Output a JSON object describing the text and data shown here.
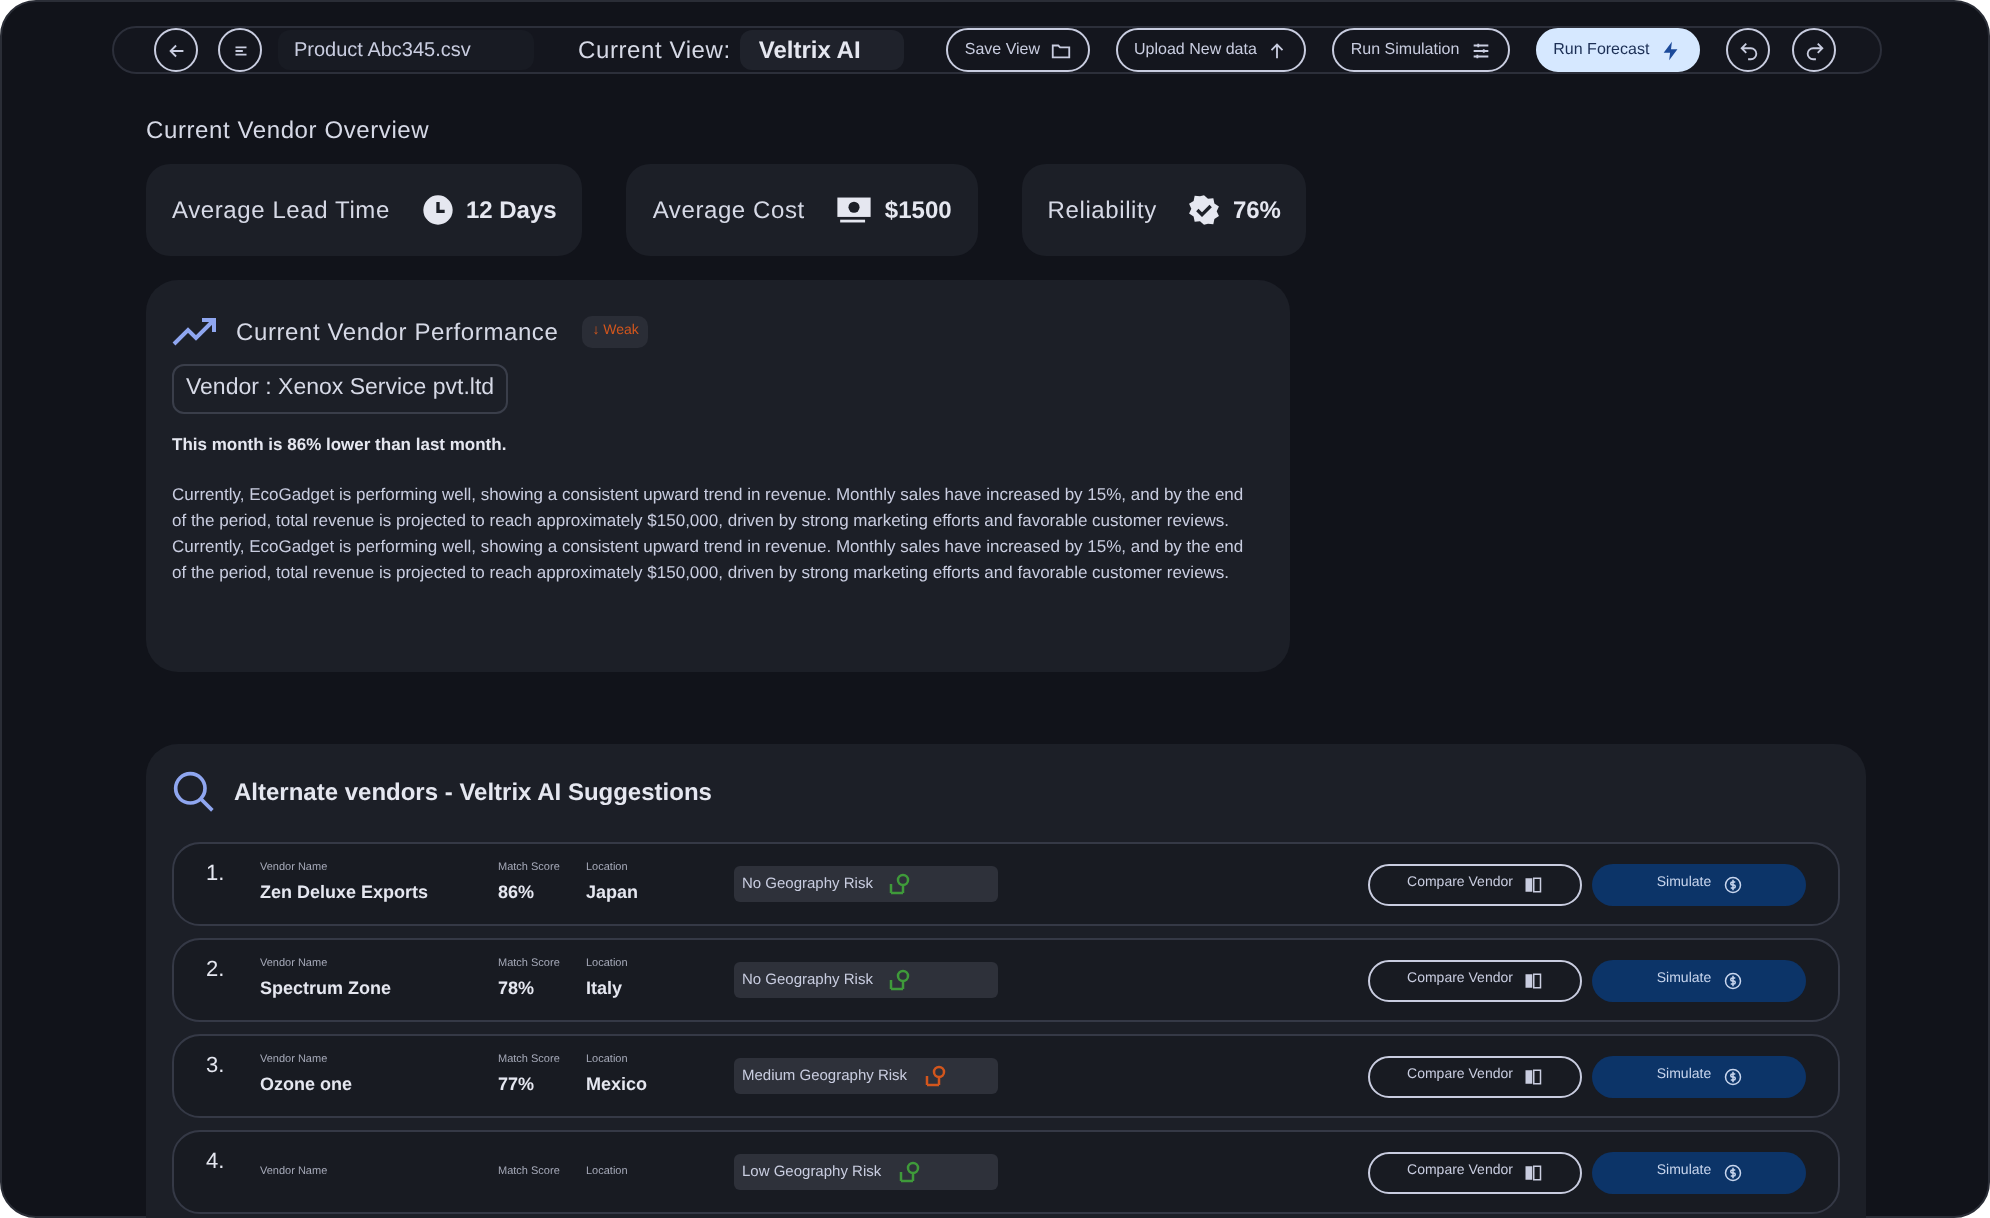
{
  "toolbar": {
    "file": "Product Abc345.csv",
    "view_label": "Current View:",
    "view_value": "Veltrix AI",
    "buttons": [
      {
        "label": "Save View",
        "kind": "folder",
        "primary": false
      },
      {
        "label": "Upload New data",
        "kind": "upload",
        "primary": false
      },
      {
        "label": "Run Simulation",
        "kind": "sliders",
        "primary": false
      },
      {
        "label": "Run Forecast",
        "kind": "bolt",
        "primary": true
      }
    ]
  },
  "overview": {
    "title": "Current Vendor Overview",
    "stats": [
      {
        "label": "Average Lead Time",
        "value": "12 Days",
        "kind": "clock"
      },
      {
        "label": "Average Cost",
        "value": "$1500",
        "kind": "cash"
      },
      {
        "label": "Reliability",
        "value": "76%",
        "kind": "badge"
      }
    ]
  },
  "performance": {
    "title": "Current Vendor Performance",
    "trend": "↓ Weak",
    "vendor": "Vendor : Xenox Service pvt.ltd",
    "summary": "This month is 86% lower than last month.",
    "body": "Currently, EcoGadget is performing well, showing a consistent upward trend in revenue. Monthly sales have increased by 15%, and by the end of the period, total revenue is projected to reach approximately $150,000, driven by strong marketing efforts and favorable customer reviews. Currently, EcoGadget is performing well, showing a consistent upward trend in revenue. Monthly sales have increased by 15%, and by the end of the period, total revenue is projected to reach approximately $150,000, driven by strong marketing efforts and favorable customer reviews."
  },
  "alternates": {
    "title": "Alternate vendors - Veltrix AI Suggestions",
    "rows": [
      {
        "index": "1.",
        "name_label": "Vendor Name",
        "name": "Zen Deluxe Exports",
        "score_label": "Match Score",
        "score": "86%",
        "location_label": "Location",
        "location": "Japan",
        "risk": "No Geography Risk",
        "color": "#3f9a3a",
        "compare": "Compare Vendor",
        "simulate": "Simulate"
      },
      {
        "index": "2.",
        "name_label": "Vendor Name",
        "name": "Spectrum Zone",
        "score_label": "Match Score",
        "score": "78%",
        "location_label": "Location",
        "location": "Italy",
        "risk": "No Geography Risk",
        "color": "#3f9a3a",
        "compare": "Compare Vendor",
        "simulate": "Simulate"
      },
      {
        "index": "3.",
        "name_label": "Vendor Name",
        "name": "Ozone one",
        "score_label": "Match Score",
        "score": "77%",
        "location_label": "Location",
        "location": "Mexico",
        "risk": "Medium Geography Risk",
        "color": "#d2561d",
        "compare": "Compare Vendor",
        "simulate": "Simulate"
      },
      {
        "index": "4.",
        "name_label": "Vendor Name",
        "score_label": "Match Score",
        "location_label": "Location",
        "risk": "Low Geography Risk",
        "color": "#3f9a3a",
        "compare": "Compare Vendor",
        "simulate": "Simulate"
      }
    ]
  }
}
